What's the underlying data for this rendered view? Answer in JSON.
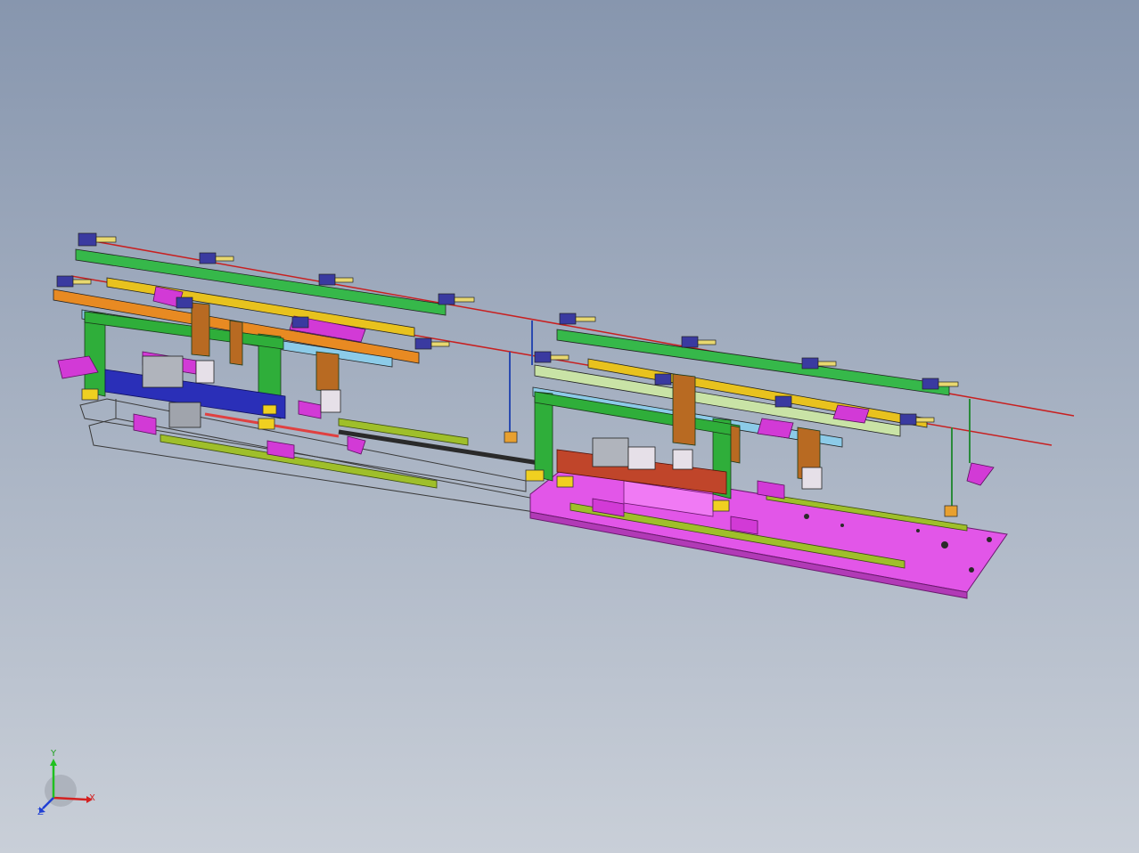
{
  "viewport": {
    "background_top": "#8796ae",
    "background_bottom": "#c9cfd8"
  },
  "colors": {
    "frame_green": "#2fae3a",
    "bar_green": "#36b84a",
    "bar_yellow": "#e8c21e",
    "bar_orange": "#e88a22",
    "bar_lightblue": "#8ccbe8",
    "bar_palegreen": "#c9e3a6",
    "bracket_magenta": "#d23ad6",
    "bracket_brown": "#b86a22",
    "slider_blue": "#2a2fb8",
    "slider_red": "#c0452a",
    "rod_red": "#c82020",
    "plate_magenta": "#e256e8",
    "rail_olive": "#9fbf2a",
    "line_dark": "#2a2a2a"
  },
  "triad": {
    "x_label": "X",
    "y_label": "Y",
    "z_label": "Z",
    "x_color": "#d42020",
    "y_color": "#20c020",
    "z_color": "#2040d4"
  }
}
